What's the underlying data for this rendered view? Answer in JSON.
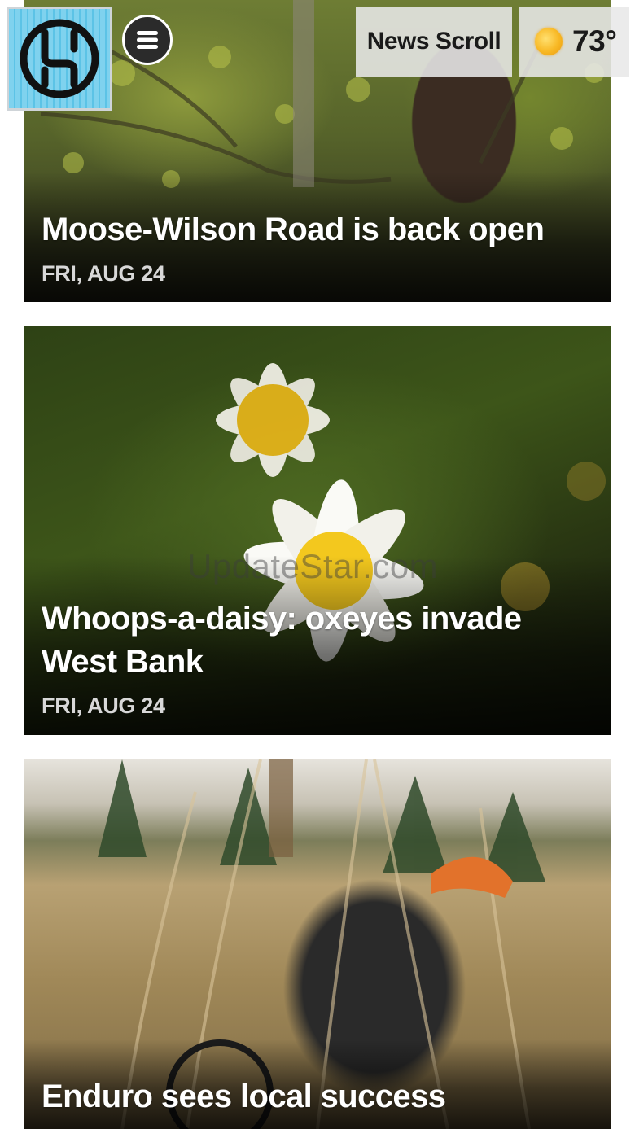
{
  "header": {
    "logo_icon": "app-logo-icon",
    "menu_icon": "hamburger-menu-icon",
    "news_scroll_label": "News Scroll",
    "weather": {
      "icon": "sun-icon",
      "temperature": "73°"
    }
  },
  "articles": [
    {
      "title": "Moose-Wilson Road is back open",
      "date": "FRI, AUG 24"
    },
    {
      "title": "Whoops-a-daisy: oxeyes invade West Bank",
      "date": "FRI, AUG 24"
    },
    {
      "title": "Enduro sees local success"
    }
  ],
  "watermark": "UpdateStar.com",
  "colors": {
    "logo_background": "#5cc3e6",
    "menu_button": "#2b2b2b",
    "sun": "#f8b824"
  }
}
